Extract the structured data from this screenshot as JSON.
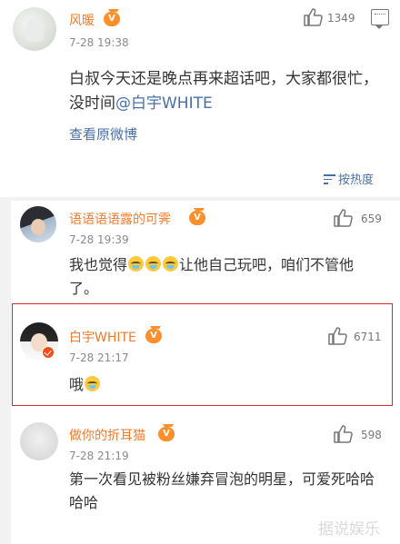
{
  "post": {
    "user": {
      "name": "风暖",
      "badge": "V",
      "avatar_icon": "user-avatar"
    },
    "time": "7-28 19:38",
    "likes": "1349",
    "text_before": "白叔今天还是晚点再来超话吧，大家都很忙，没时间",
    "mention": "@白宇WHITE",
    "view_original": "查看原微博",
    "sort_label": "按热度"
  },
  "comments": [
    {
      "name": "语语语语露的可霁",
      "badge": "V",
      "time": "7-28 19:39",
      "likes": "659",
      "text_a": "我也觉得",
      "text_b": "让他自己玩吧，咱们不管他了。"
    },
    {
      "name": "白宇WHITE",
      "badge": "V",
      "time": "7-28 21:17",
      "likes": "6711",
      "text_a": "哦"
    },
    {
      "name": "做你的折耳猫",
      "badge": "V",
      "time": "7-28 21:19",
      "likes": "598",
      "text_a": "第一次看见被粉丝嫌弃冒泡的明星，可爱死哈哈哈哈"
    }
  ],
  "watermark": "据说娱乐",
  "colors": {
    "username": "#f27b2a",
    "link": "#4a6fa8",
    "highlight": "#d9262a"
  }
}
